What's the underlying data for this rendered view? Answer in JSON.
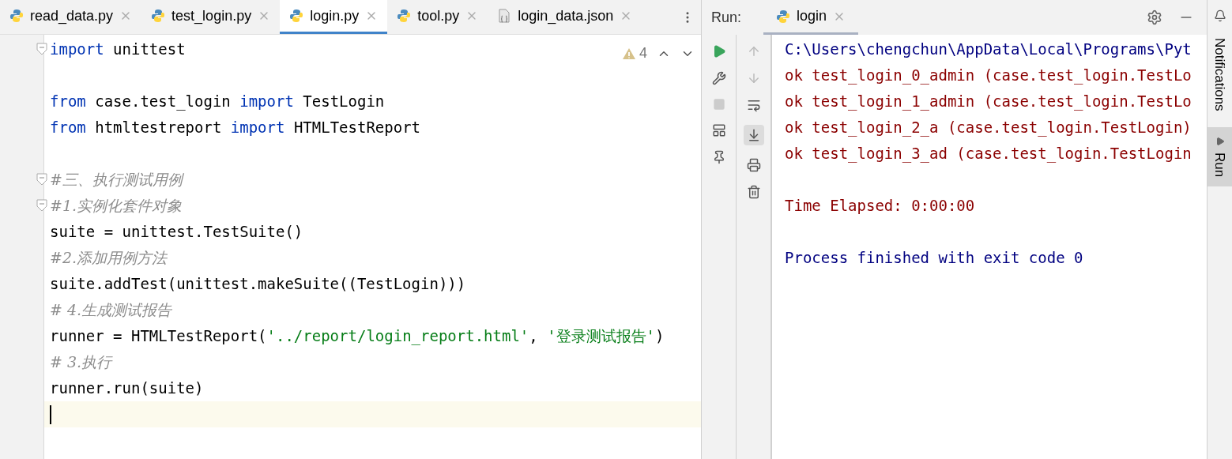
{
  "editor_tabs": [
    {
      "label": "read_data.py",
      "kind": "python",
      "selected": false
    },
    {
      "label": "test_login.py",
      "kind": "python",
      "selected": false
    },
    {
      "label": "login.py",
      "kind": "python",
      "selected": true
    },
    {
      "label": "tool.py",
      "kind": "python",
      "selected": false
    },
    {
      "label": "login_data.json",
      "kind": "json",
      "selected": false
    }
  ],
  "inspections": {
    "warnings": "4"
  },
  "code_lines": [
    {
      "kind": "code",
      "fold": true,
      "current": false,
      "tokens": [
        {
          "kind": "keyword",
          "text": "import"
        },
        {
          "kind": "plain",
          "text": " unittest"
        }
      ]
    },
    {
      "kind": "blank"
    },
    {
      "kind": "code",
      "fold": false,
      "current": false,
      "tokens": [
        {
          "kind": "keyword",
          "text": "from"
        },
        {
          "kind": "plain",
          "text": " case.test_login "
        },
        {
          "kind": "keyword",
          "text": "import"
        },
        {
          "kind": "plain",
          "text": " TestLogin"
        }
      ]
    },
    {
      "kind": "code",
      "fold": false,
      "current": false,
      "tokens": [
        {
          "kind": "keyword",
          "text": "from"
        },
        {
          "kind": "plain",
          "text": " htmltestreport "
        },
        {
          "kind": "keyword",
          "text": "import"
        },
        {
          "kind": "plain",
          "text": " HTMLTestReport"
        }
      ]
    },
    {
      "kind": "blank"
    },
    {
      "kind": "code",
      "fold": true,
      "current": false,
      "tokens": [
        {
          "kind": "comment",
          "text": "#三、执行测试用例"
        }
      ]
    },
    {
      "kind": "code",
      "fold": true,
      "current": false,
      "tokens": [
        {
          "kind": "comment",
          "text": "#1.实例化套件对象"
        }
      ]
    },
    {
      "kind": "code",
      "fold": false,
      "current": false,
      "tokens": [
        {
          "kind": "plain",
          "text": "suite = unittest.TestSuite()"
        }
      ]
    },
    {
      "kind": "code",
      "fold": false,
      "current": false,
      "tokens": [
        {
          "kind": "comment",
          "text": "#2.添加用例方法"
        }
      ]
    },
    {
      "kind": "code",
      "fold": false,
      "current": false,
      "tokens": [
        {
          "kind": "plain",
          "text": "suite.addTest(unittest.makeSuite((TestLogin)))"
        }
      ]
    },
    {
      "kind": "code",
      "fold": false,
      "current": false,
      "tokens": [
        {
          "kind": "comment",
          "text": "# 4.生成测试报告"
        }
      ]
    },
    {
      "kind": "code",
      "fold": false,
      "current": false,
      "tokens": [
        {
          "kind": "plain",
          "text": "runner = HTMLTestReport("
        },
        {
          "kind": "string",
          "text": "'../report/login_report.html'"
        },
        {
          "kind": "plain",
          "text": ", "
        },
        {
          "kind": "string",
          "text": "'登录测试报告'"
        },
        {
          "kind": "plain",
          "text": ")"
        }
      ]
    },
    {
      "kind": "code",
      "fold": false,
      "current": false,
      "tokens": [
        {
          "kind": "comment",
          "text": "# 3.执行"
        }
      ]
    },
    {
      "kind": "code",
      "fold": false,
      "current": false,
      "tokens": [
        {
          "kind": "plain",
          "text": "runner.run(suite)"
        }
      ]
    },
    {
      "kind": "cursor",
      "fold": false,
      "current": true
    }
  ],
  "run_panel": {
    "title": "Run:",
    "tab": {
      "label": "login",
      "selected": true
    },
    "console": [
      {
        "kind": "command",
        "text": "C:\\Users\\chengchun\\AppData\\Local\\Programs\\Pyt"
      },
      {
        "kind": "output",
        "text": "ok test_login_0_admin (case.test_login.TestLo"
      },
      {
        "kind": "output",
        "text": "ok test_login_1_admin (case.test_login.TestLo"
      },
      {
        "kind": "output",
        "text": "ok test_login_2_a (case.test_login.TestLogin)"
      },
      {
        "kind": "output",
        "text": "ok test_login_3_ad (case.test_login.TestLogin"
      },
      {
        "kind": "blank"
      },
      {
        "kind": "output",
        "text": "Time Elapsed: 0:00:00"
      },
      {
        "kind": "blank"
      },
      {
        "kind": "command",
        "text": "Process finished with exit code 0"
      }
    ]
  },
  "side_strip": [
    {
      "label": "Notifications",
      "selected": false
    },
    {
      "label": "Run",
      "selected": true
    }
  ]
}
